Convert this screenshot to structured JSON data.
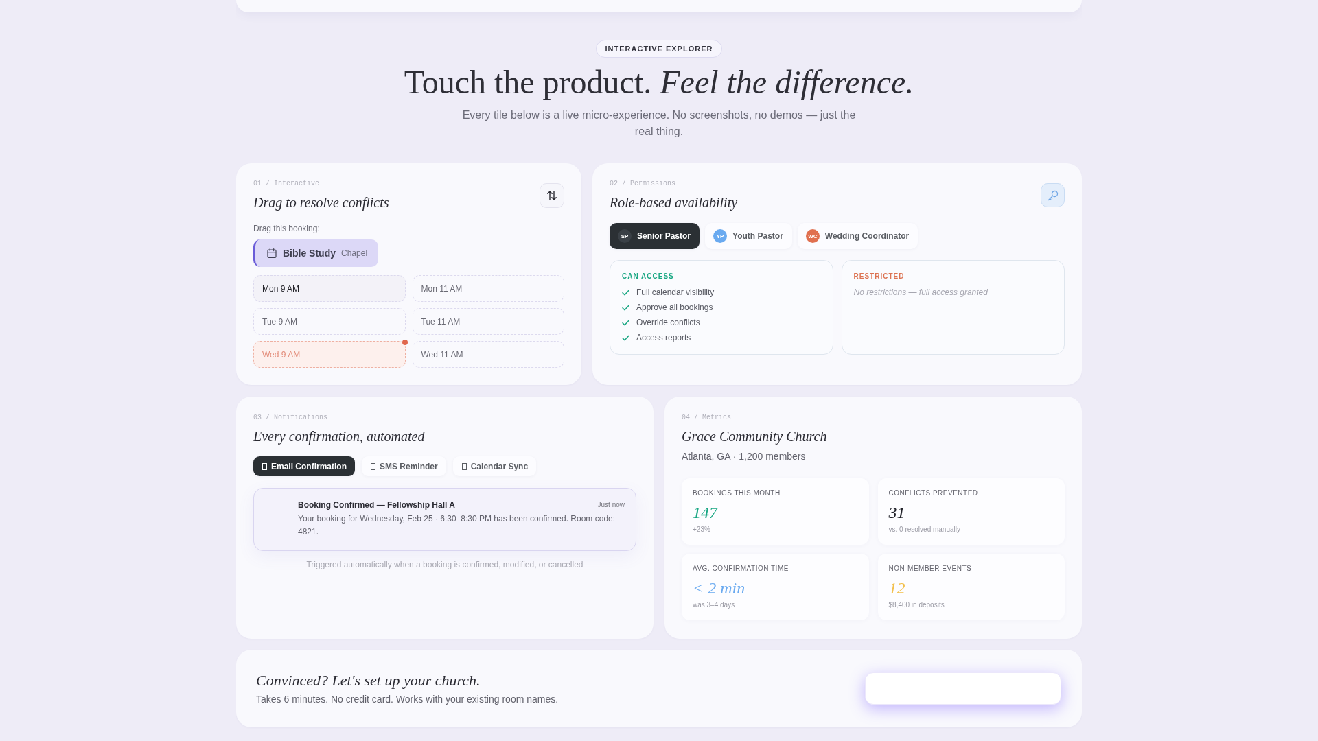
{
  "header": {
    "badge": "INTERACTIVE EXPLORER",
    "title": "Touch the product. *Feel the difference.*",
    "subtitle": "Every tile below is a live micro-experience. No screenshots, no demos — just the real thing."
  },
  "conflicts": {
    "eyebrow": "01 / Interactive",
    "title": "Drag to resolve conflicts",
    "prompt": "Drag this booking:",
    "booking": {
      "name": "Bible Study",
      "room": "Chapel"
    },
    "slots": [
      {
        "label": "Mon 9 AM",
        "selected": true,
        "conflict": false
      },
      {
        "label": "Mon 11 AM",
        "selected": false,
        "conflict": false
      },
      {
        "label": "Tue 9 AM",
        "selected": false,
        "conflict": false
      },
      {
        "label": "Tue 11 AM",
        "selected": false,
        "conflict": false
      },
      {
        "label": "Wed 9 AM",
        "selected": false,
        "conflict": true
      },
      {
        "label": "Wed 11 AM",
        "selected": false,
        "conflict": false
      }
    ]
  },
  "permissions": {
    "eyebrow": "02 / Permissions",
    "title": "Role-based availability",
    "roles": [
      {
        "initials": "SP",
        "name": "Senior Pastor",
        "selected": true,
        "color": "#3a4046"
      },
      {
        "initials": "YP",
        "name": "Youth Pastor",
        "selected": false,
        "color": "#6aaaf0"
      },
      {
        "initials": "WC",
        "name": "Wedding Coordinator",
        "selected": false,
        "color": "#e0704f"
      }
    ],
    "access": {
      "heading": "CAN ACCESS",
      "items": [
        "Full calendar visibility",
        "Approve all bookings",
        "Override conflicts",
        "Access reports"
      ]
    },
    "restricted": {
      "heading": "RESTRICTED",
      "note": "No restrictions — full access granted"
    }
  },
  "notifications": {
    "eyebrow": "03 / Notifications",
    "title": "Every confirmation, automated",
    "channels": [
      {
        "label": "Email Confirmation",
        "selected": true
      },
      {
        "label": "SMS Reminder",
        "selected": false
      },
      {
        "label": "Calendar Sync",
        "selected": false
      }
    ],
    "message": {
      "title": "Booking Confirmed — Fellowship Hall A",
      "time": "Just now",
      "body": "Your booking for Wednesday, Feb 25 · 6:30–8:30 PM has been confirmed. Room code: 4821."
    },
    "footnote": "Triggered automatically when a booking is confirmed, modified, or cancelled"
  },
  "metrics": {
    "eyebrow": "04 / Metrics",
    "title": "Grace Community Church",
    "subtitle": "Atlanta, GA · 1,200 members",
    "stats": [
      {
        "label": "BOOKINGS THIS MONTH",
        "value": "147",
        "note": "+23%",
        "color": "#1aa783"
      },
      {
        "label": "CONFLICTS PREVENTED",
        "value": "31",
        "note": "vs. 0 resolved manually",
        "color": "#22232a"
      },
      {
        "label": "AVG. CONFIRMATION TIME",
        "value": "< 2 min",
        "note": "was 3–4 days",
        "color": "#6aaaf0"
      },
      {
        "label": "NON-MEMBER EVENTS",
        "value": "12",
        "note": "$8,400 in deposits",
        "color": "#f2c04e"
      }
    ]
  },
  "cta": {
    "title": "Convinced? Let's set up your church.",
    "subtitle": "Takes 6 minutes. No credit card. Works with your existing room names."
  }
}
